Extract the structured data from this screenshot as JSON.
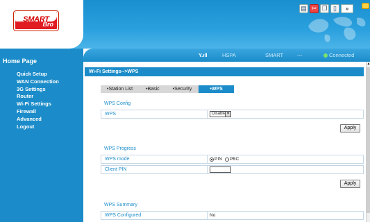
{
  "header": {
    "logo_word": "SMART",
    "logo_sub": "Bro",
    "toolbar_icons": [
      "save-icon",
      "cut-icon",
      "copy-icon",
      "page-icon"
    ],
    "more_label": "»"
  },
  "sidebar": {
    "home": "Home Page",
    "items": [
      "Quick Setup",
      "WAN Connection",
      "3G Settings",
      "Router",
      "Wi-Fi Settings",
      "Firewall",
      "Advanced",
      "Logout"
    ]
  },
  "status": {
    "signal": "Y.ıll",
    "network": "HSPA",
    "operator": "SMART",
    "separator": "---",
    "connection": "Connected"
  },
  "page": {
    "breadcrumb": "Wi-Fi Settings-->WPS",
    "tabs": [
      "•Station List",
      "•Basic",
      "•Security",
      "•WPS"
    ],
    "wps_config": {
      "heading": "WPS Config",
      "wps_label": "WPS",
      "wps_value": "Disable",
      "apply": "Apply"
    },
    "wps_progress": {
      "heading": "WPS Progress",
      "mode_label": "WPS mode",
      "pin_label": "PIN",
      "pbc_label": "PBC",
      "client_pin_label": "Client PIN",
      "client_pin_value": "",
      "apply": "Apply"
    },
    "wps_summary": {
      "heading": "WPS Summary",
      "configured_label": "WPS Configured",
      "configured_value": "No"
    }
  },
  "colors": {
    "accent": "#1b8cc9",
    "brand_red": "#e11b22",
    "connected": "#7be26b"
  }
}
